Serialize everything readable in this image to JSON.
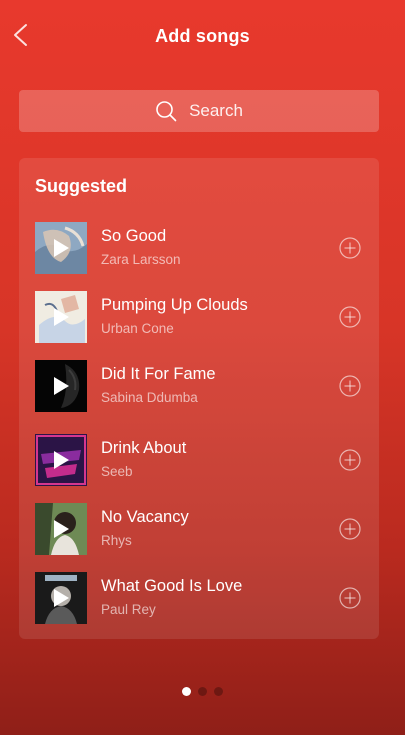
{
  "header": {
    "title": "Add songs",
    "back_icon": "chevron-left-icon"
  },
  "search": {
    "label": "Search",
    "icon": "search-icon"
  },
  "suggested": {
    "heading": "Suggested",
    "songs": [
      {
        "title": "So Good",
        "artist": "Zara Larsson",
        "art_colors": [
          "#8fa9c4",
          "#5e7a96"
        ]
      },
      {
        "title": "Pumping Up Clouds",
        "artist": "Urban Cone",
        "art_colors": [
          "#f2efe6",
          "#c9d6e8"
        ]
      },
      {
        "title": "Did It For Fame",
        "artist": "Sabina Ddumba",
        "art_colors": [
          "#050505",
          "#2a2a2a"
        ]
      },
      {
        "title": "Drink About",
        "artist": "Seeb",
        "art_colors": [
          "#3a1a5e",
          "#c42c8c"
        ]
      },
      {
        "title": "No Vacancy",
        "artist": "Rhys",
        "art_colors": [
          "#6e8a55",
          "#2e3d24"
        ]
      },
      {
        "title": "What Good Is Love",
        "artist": "Paul Rey",
        "art_colors": [
          "#1c1c1c",
          "#6b6b6b"
        ]
      }
    ]
  },
  "pager": {
    "pages": 3,
    "active_index": 0
  },
  "colors": {
    "background_top": "#e8392d",
    "background_bottom": "#8f1f18"
  }
}
